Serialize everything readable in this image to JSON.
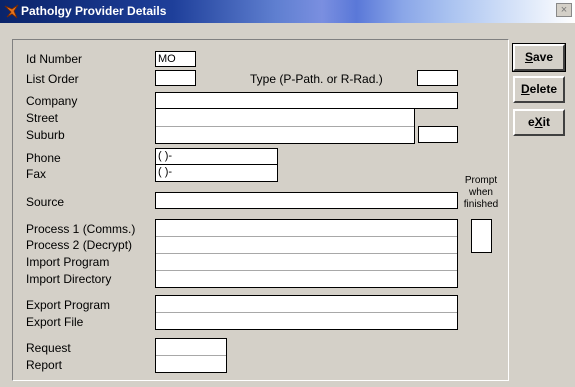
{
  "window": {
    "title": "Patholgy Provider Details",
    "close_label": "×"
  },
  "form": {
    "id_number_label": "Id Number",
    "id_number_value": "MO",
    "list_order_label": "List Order",
    "list_order_value": "",
    "type_label": "Type (P-Path. or R-Rad.)",
    "type_value": "",
    "company_label": "Company",
    "street_label": "Street",
    "suburb_label": "Suburb",
    "phone_label": "Phone",
    "phone_value": "( )-",
    "fax_label": "Fax",
    "fax_value": "( )-",
    "source_label": "Source",
    "prompt_label": "Prompt when finished",
    "process1_label": "Process 1 (Comms.)",
    "process2_label": "Process 2 (Decrypt)",
    "import_program_label": "Import Program",
    "import_directory_label": "Import Directory",
    "export_program_label": "Export Program",
    "export_file_label": "Export File",
    "request_label": "Request",
    "report_label": "Report"
  },
  "buttons": {
    "save": {
      "pre": "",
      "key": "S",
      "post": "ave"
    },
    "delete": {
      "pre": "",
      "key": "D",
      "post": "elete"
    },
    "exit": {
      "pre": "e",
      "key": "X",
      "post": "it"
    }
  }
}
